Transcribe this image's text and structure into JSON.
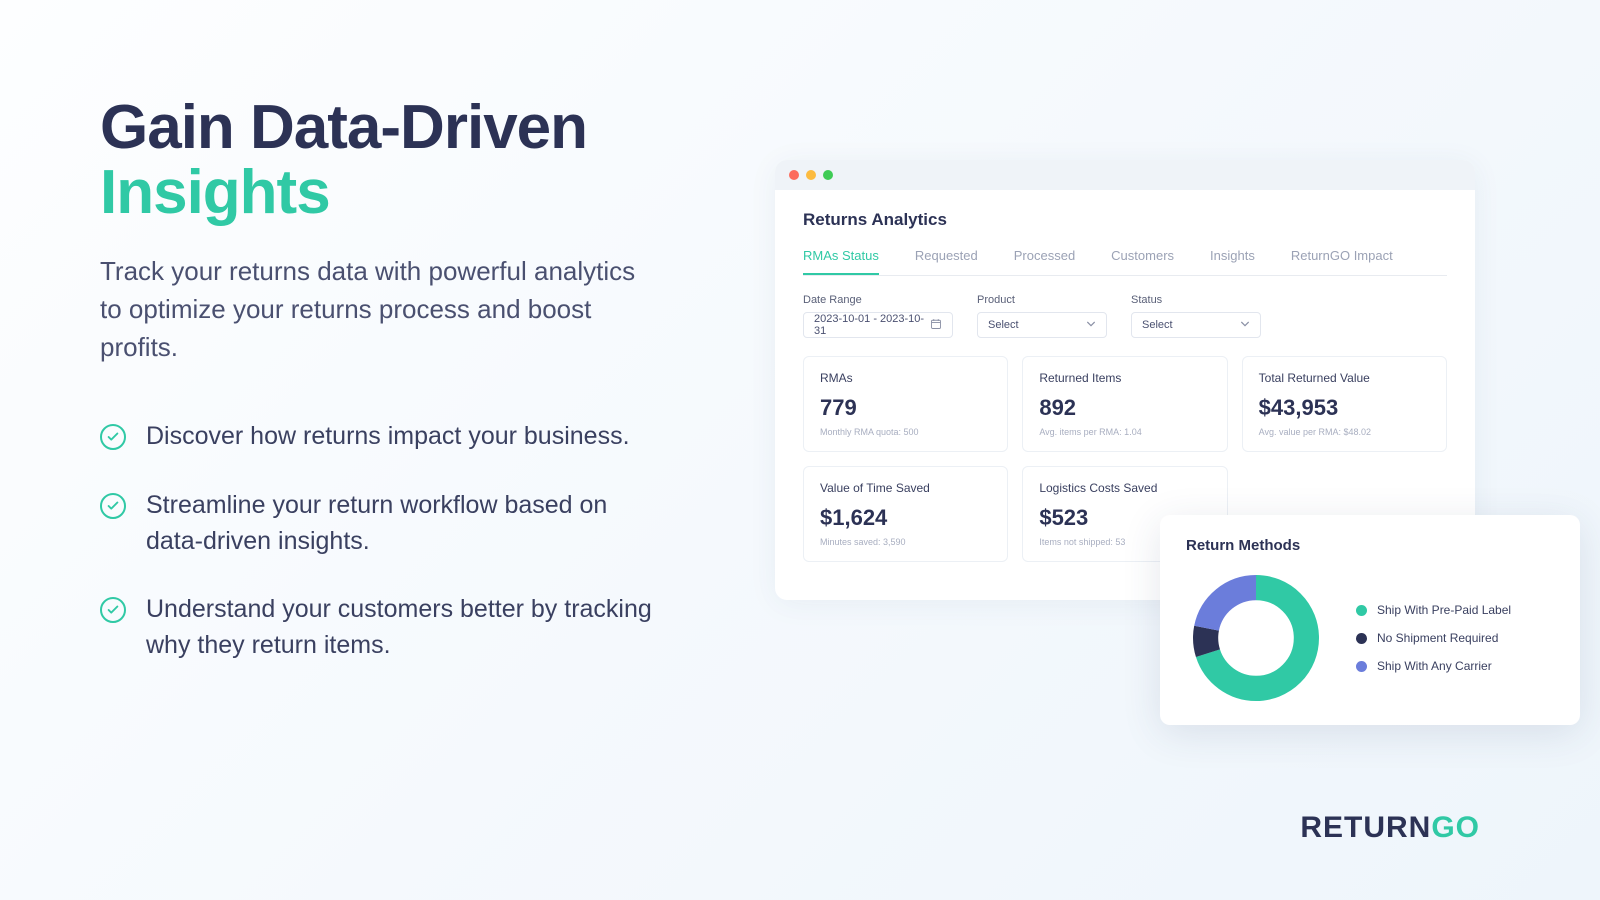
{
  "headline": {
    "line1": "Gain Data-Driven",
    "line2": "Insights"
  },
  "subhead": "Track your returns data with powerful analytics to optimize your returns process and boost profits.",
  "bullets": [
    "Discover how returns impact your business.",
    "Streamline your return workflow based on data-driven insights.",
    "Understand your customers better by tracking why they return items."
  ],
  "app": {
    "title": "Returns Analytics",
    "tabs": [
      "RMAs Status",
      "Requested",
      "Processed",
      "Customers",
      "Insights",
      "ReturnGO Impact"
    ],
    "active_tab": 0,
    "filters": {
      "date_label": "Date Range",
      "date_value": "2023-10-01 - 2023-10-31",
      "product_label": "Product",
      "product_value": "Select",
      "status_label": "Status",
      "status_value": "Select"
    },
    "metrics": [
      {
        "label": "RMAs",
        "value": "779",
        "sub": "Monthly RMA quota: 500"
      },
      {
        "label": "Returned Items",
        "value": "892",
        "sub": "Avg. items per RMA: 1.04"
      },
      {
        "label": "Total Returned Value",
        "value": "$43,953",
        "sub": "Avg. value per RMA: $48.02"
      },
      {
        "label": "Value of Time Saved",
        "value": "$1,624",
        "sub": "Minutes saved: 3,590"
      },
      {
        "label": "Logistics Costs Saved",
        "value": "$523",
        "sub": "Items not shipped: 53"
      }
    ]
  },
  "donut": {
    "title": "Return Methods",
    "legend": [
      {
        "color": "#30c9a5",
        "label": "Ship With Pre-Paid Label"
      },
      {
        "color": "#2c3255",
        "label": "No Shipment Required"
      },
      {
        "color": "#6b7ddb",
        "label": "Ship With Any Carrier"
      }
    ]
  },
  "chart_data": {
    "type": "pie",
    "title": "Return Methods",
    "series": [
      {
        "name": "Ship With Pre-Paid Label",
        "value": 70,
        "color": "#30c9a5"
      },
      {
        "name": "No Shipment Required",
        "value": 8,
        "color": "#2c3255"
      },
      {
        "name": "Ship With Any Carrier",
        "value": 22,
        "color": "#6b7ddb"
      }
    ]
  },
  "brand": {
    "part1": "RETURN",
    "part2": "GO"
  }
}
